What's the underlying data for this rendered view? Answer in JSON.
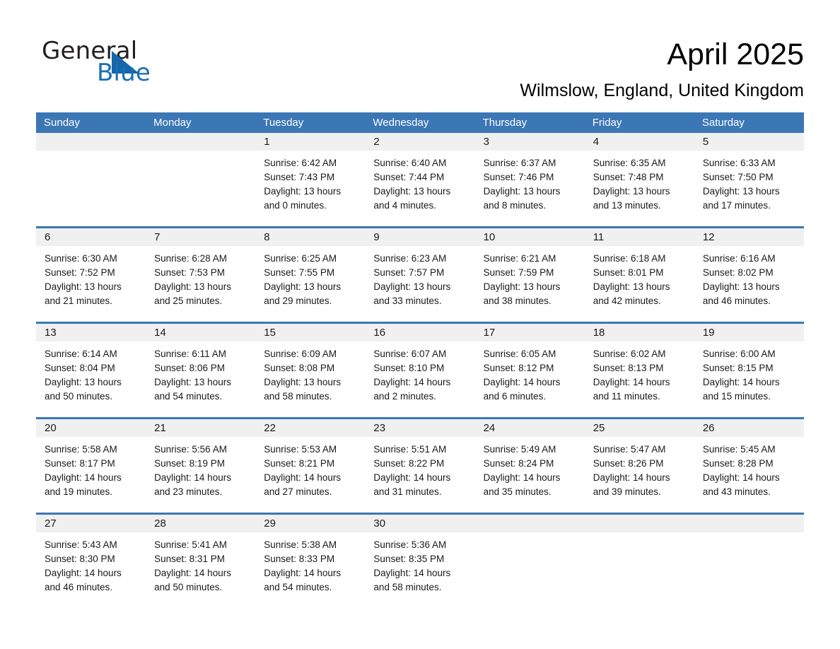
{
  "brand": {
    "name_part1": "General",
    "name_part2": "Blue"
  },
  "header": {
    "title": "April 2025",
    "location": "Wilmslow, England, United Kingdom"
  },
  "calendar": {
    "weekday_headers": [
      "Sunday",
      "Monday",
      "Tuesday",
      "Wednesday",
      "Thursday",
      "Friday",
      "Saturday"
    ],
    "colors": {
      "header_blue": "#3c77b5",
      "daynum_band": "#f0f0f0",
      "brand_blue": "#1a6fb5",
      "text": "#1a1a1a"
    },
    "weeks": [
      [
        {
          "day": "",
          "sunrise": "",
          "sunset": "",
          "daylight_line1": "",
          "daylight_line2": ""
        },
        {
          "day": "",
          "sunrise": "",
          "sunset": "",
          "daylight_line1": "",
          "daylight_line2": ""
        },
        {
          "day": "1",
          "sunrise": "Sunrise: 6:42 AM",
          "sunset": "Sunset: 7:43 PM",
          "daylight_line1": "Daylight: 13 hours",
          "daylight_line2": "and 0 minutes."
        },
        {
          "day": "2",
          "sunrise": "Sunrise: 6:40 AM",
          "sunset": "Sunset: 7:44 PM",
          "daylight_line1": "Daylight: 13 hours",
          "daylight_line2": "and 4 minutes."
        },
        {
          "day": "3",
          "sunrise": "Sunrise: 6:37 AM",
          "sunset": "Sunset: 7:46 PM",
          "daylight_line1": "Daylight: 13 hours",
          "daylight_line2": "and 8 minutes."
        },
        {
          "day": "4",
          "sunrise": "Sunrise: 6:35 AM",
          "sunset": "Sunset: 7:48 PM",
          "daylight_line1": "Daylight: 13 hours",
          "daylight_line2": "and 13 minutes."
        },
        {
          "day": "5",
          "sunrise": "Sunrise: 6:33 AM",
          "sunset": "Sunset: 7:50 PM",
          "daylight_line1": "Daylight: 13 hours",
          "daylight_line2": "and 17 minutes."
        }
      ],
      [
        {
          "day": "6",
          "sunrise": "Sunrise: 6:30 AM",
          "sunset": "Sunset: 7:52 PM",
          "daylight_line1": "Daylight: 13 hours",
          "daylight_line2": "and 21 minutes."
        },
        {
          "day": "7",
          "sunrise": "Sunrise: 6:28 AM",
          "sunset": "Sunset: 7:53 PM",
          "daylight_line1": "Daylight: 13 hours",
          "daylight_line2": "and 25 minutes."
        },
        {
          "day": "8",
          "sunrise": "Sunrise: 6:25 AM",
          "sunset": "Sunset: 7:55 PM",
          "daylight_line1": "Daylight: 13 hours",
          "daylight_line2": "and 29 minutes."
        },
        {
          "day": "9",
          "sunrise": "Sunrise: 6:23 AM",
          "sunset": "Sunset: 7:57 PM",
          "daylight_line1": "Daylight: 13 hours",
          "daylight_line2": "and 33 minutes."
        },
        {
          "day": "10",
          "sunrise": "Sunrise: 6:21 AM",
          "sunset": "Sunset: 7:59 PM",
          "daylight_line1": "Daylight: 13 hours",
          "daylight_line2": "and 38 minutes."
        },
        {
          "day": "11",
          "sunrise": "Sunrise: 6:18 AM",
          "sunset": "Sunset: 8:01 PM",
          "daylight_line1": "Daylight: 13 hours",
          "daylight_line2": "and 42 minutes."
        },
        {
          "day": "12",
          "sunrise": "Sunrise: 6:16 AM",
          "sunset": "Sunset: 8:02 PM",
          "daylight_line1": "Daylight: 13 hours",
          "daylight_line2": "and 46 minutes."
        }
      ],
      [
        {
          "day": "13",
          "sunrise": "Sunrise: 6:14 AM",
          "sunset": "Sunset: 8:04 PM",
          "daylight_line1": "Daylight: 13 hours",
          "daylight_line2": "and 50 minutes."
        },
        {
          "day": "14",
          "sunrise": "Sunrise: 6:11 AM",
          "sunset": "Sunset: 8:06 PM",
          "daylight_line1": "Daylight: 13 hours",
          "daylight_line2": "and 54 minutes."
        },
        {
          "day": "15",
          "sunrise": "Sunrise: 6:09 AM",
          "sunset": "Sunset: 8:08 PM",
          "daylight_line1": "Daylight: 13 hours",
          "daylight_line2": "and 58 minutes."
        },
        {
          "day": "16",
          "sunrise": "Sunrise: 6:07 AM",
          "sunset": "Sunset: 8:10 PM",
          "daylight_line1": "Daylight: 14 hours",
          "daylight_line2": "and 2 minutes."
        },
        {
          "day": "17",
          "sunrise": "Sunrise: 6:05 AM",
          "sunset": "Sunset: 8:12 PM",
          "daylight_line1": "Daylight: 14 hours",
          "daylight_line2": "and 6 minutes."
        },
        {
          "day": "18",
          "sunrise": "Sunrise: 6:02 AM",
          "sunset": "Sunset: 8:13 PM",
          "daylight_line1": "Daylight: 14 hours",
          "daylight_line2": "and 11 minutes."
        },
        {
          "day": "19",
          "sunrise": "Sunrise: 6:00 AM",
          "sunset": "Sunset: 8:15 PM",
          "daylight_line1": "Daylight: 14 hours",
          "daylight_line2": "and 15 minutes."
        }
      ],
      [
        {
          "day": "20",
          "sunrise": "Sunrise: 5:58 AM",
          "sunset": "Sunset: 8:17 PM",
          "daylight_line1": "Daylight: 14 hours",
          "daylight_line2": "and 19 minutes."
        },
        {
          "day": "21",
          "sunrise": "Sunrise: 5:56 AM",
          "sunset": "Sunset: 8:19 PM",
          "daylight_line1": "Daylight: 14 hours",
          "daylight_line2": "and 23 minutes."
        },
        {
          "day": "22",
          "sunrise": "Sunrise: 5:53 AM",
          "sunset": "Sunset: 8:21 PM",
          "daylight_line1": "Daylight: 14 hours",
          "daylight_line2": "and 27 minutes."
        },
        {
          "day": "23",
          "sunrise": "Sunrise: 5:51 AM",
          "sunset": "Sunset: 8:22 PM",
          "daylight_line1": "Daylight: 14 hours",
          "daylight_line2": "and 31 minutes."
        },
        {
          "day": "24",
          "sunrise": "Sunrise: 5:49 AM",
          "sunset": "Sunset: 8:24 PM",
          "daylight_line1": "Daylight: 14 hours",
          "daylight_line2": "and 35 minutes."
        },
        {
          "day": "25",
          "sunrise": "Sunrise: 5:47 AM",
          "sunset": "Sunset: 8:26 PM",
          "daylight_line1": "Daylight: 14 hours",
          "daylight_line2": "and 39 minutes."
        },
        {
          "day": "26",
          "sunrise": "Sunrise: 5:45 AM",
          "sunset": "Sunset: 8:28 PM",
          "daylight_line1": "Daylight: 14 hours",
          "daylight_line2": "and 43 minutes."
        }
      ],
      [
        {
          "day": "27",
          "sunrise": "Sunrise: 5:43 AM",
          "sunset": "Sunset: 8:30 PM",
          "daylight_line1": "Daylight: 14 hours",
          "daylight_line2": "and 46 minutes."
        },
        {
          "day": "28",
          "sunrise": "Sunrise: 5:41 AM",
          "sunset": "Sunset: 8:31 PM",
          "daylight_line1": "Daylight: 14 hours",
          "daylight_line2": "and 50 minutes."
        },
        {
          "day": "29",
          "sunrise": "Sunrise: 5:38 AM",
          "sunset": "Sunset: 8:33 PM",
          "daylight_line1": "Daylight: 14 hours",
          "daylight_line2": "and 54 minutes."
        },
        {
          "day": "30",
          "sunrise": "Sunrise: 5:36 AM",
          "sunset": "Sunset: 8:35 PM",
          "daylight_line1": "Daylight: 14 hours",
          "daylight_line2": "and 58 minutes."
        },
        {
          "day": "",
          "sunrise": "",
          "sunset": "",
          "daylight_line1": "",
          "daylight_line2": ""
        },
        {
          "day": "",
          "sunrise": "",
          "sunset": "",
          "daylight_line1": "",
          "daylight_line2": ""
        },
        {
          "day": "",
          "sunrise": "",
          "sunset": "",
          "daylight_line1": "",
          "daylight_line2": ""
        }
      ]
    ]
  }
}
